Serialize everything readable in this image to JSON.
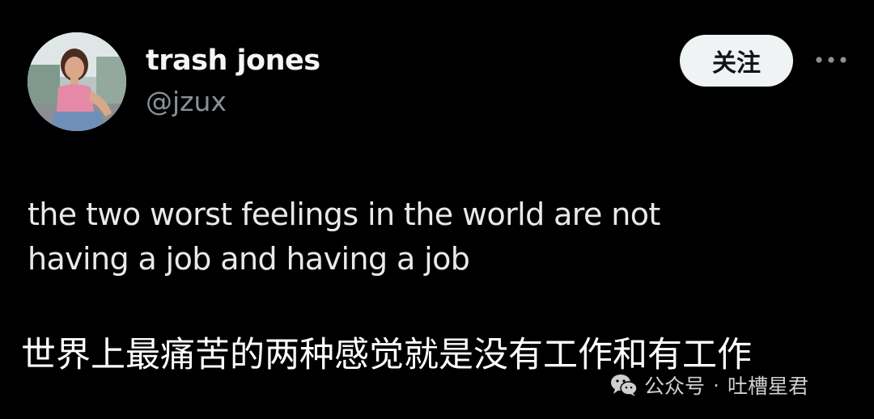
{
  "tweet": {
    "author_name": "trash jones",
    "author_handle": "@jzux",
    "follow_label": "关注",
    "text_line1": "the two worst feelings in the world are not",
    "text_line2": "having a job and having a job"
  },
  "caption": "世界上最痛苦的两种感觉就是没有工作和有工作",
  "watermark": {
    "icon": "wechat-icon",
    "label": "公众号",
    "separator": "·",
    "account": "吐槽星君"
  },
  "icons": {
    "more": "more-horizontal-icon",
    "avatar": "profile-photo"
  },
  "colors": {
    "background": "#000000",
    "text_primary": "#e7e9ea",
    "text_secondary": "#8b9096",
    "button_bg": "#eff3f4",
    "button_text": "#0f1419"
  }
}
